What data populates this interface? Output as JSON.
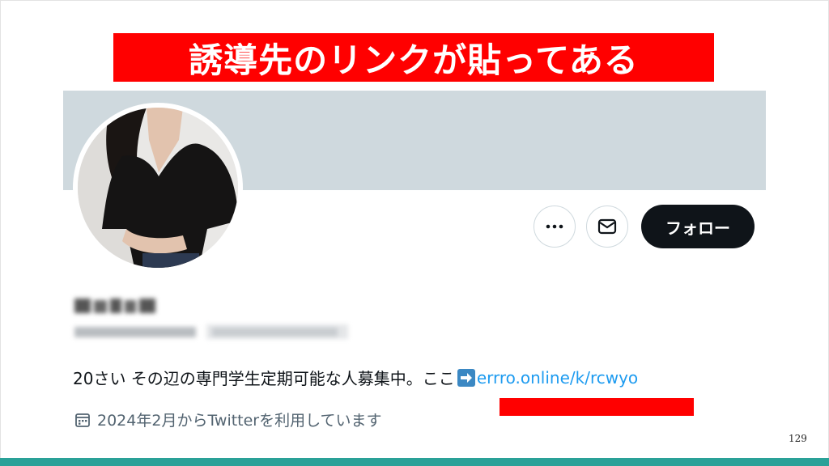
{
  "slide": {
    "title": "誘導先のリンクが貼ってある",
    "page_number": "129"
  },
  "profile": {
    "follow_label": "フォロー",
    "bio_text": "20さい その辺の専門学生定期可能な人募集中。ここ",
    "bio_link": "errro.online/k/rcwyo",
    "joined_text": "2024年2月からTwitterを利用しています"
  },
  "colors": {
    "banner_red": "#ff0000",
    "header_gray": "#cfd9de",
    "link_blue": "#1d9bf0",
    "footer_teal": "#2aa198",
    "follow_button": "#0f1419"
  },
  "icons": {
    "more": "more-icon",
    "message": "envelope-icon",
    "arrow": "right-arrow-icon",
    "calendar": "calendar-icon"
  }
}
